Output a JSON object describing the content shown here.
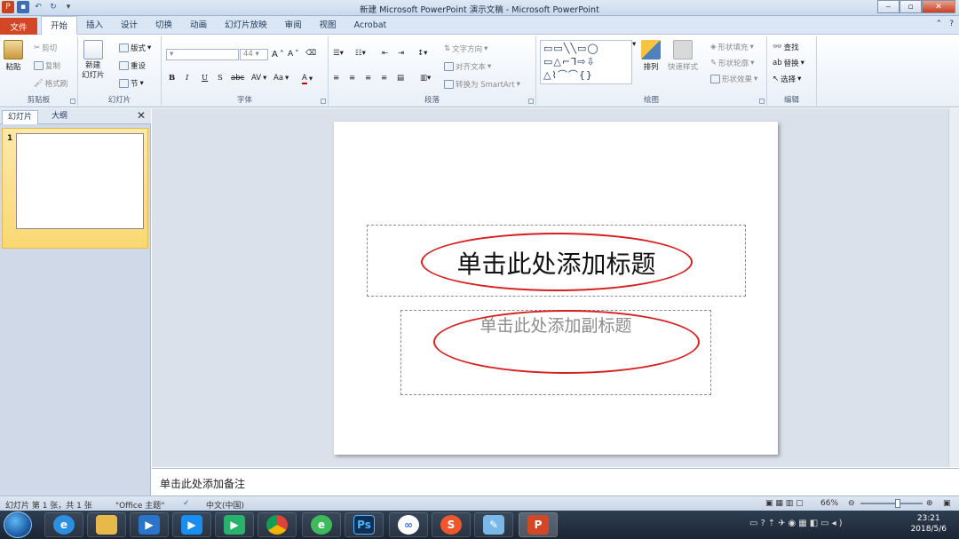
{
  "window": {
    "title": "新建 Microsoft PowerPoint 演示文稿 - Microsoft PowerPoint",
    "ppt_letter": "P",
    "min": "‒",
    "max": "▫",
    "close": "✕"
  },
  "tabs": {
    "file": "文件",
    "items": [
      "开始",
      "插入",
      "设计",
      "切换",
      "动画",
      "幻灯片放映",
      "审阅",
      "视图",
      "Acrobat"
    ],
    "active": "开始",
    "help": "?"
  },
  "ribbon": {
    "clipboard": {
      "paste": "粘贴",
      "cut": "剪切",
      "copy": "复制",
      "format_painter": "格式刷",
      "label": "剪贴板"
    },
    "slides": {
      "new_slide": "新建\n幻灯片",
      "layout": "版式",
      "reset": "重设",
      "section": "节",
      "label": "幻灯片"
    },
    "font": {
      "size": "44",
      "label": "字体",
      "grow": "A",
      "shrink": "A",
      "bold": "B",
      "italic": "I",
      "underline": "U",
      "strike": "S",
      "shadow": "abc",
      "spacing": "AV",
      "case": "Aa",
      "color": "A"
    },
    "paragraph": {
      "text_direction": "文字方向",
      "align_text": "对齐文本",
      "smartart": "转换为 SmartArt",
      "label": "段落"
    },
    "drawing": {
      "arrange": "排列",
      "quick_styles": "快速样式",
      "shape_fill": "形状填充",
      "shape_outline": "形状轮廓",
      "shape_effects": "形状效果",
      "label": "绘图"
    },
    "editing": {
      "find": "查找",
      "replace": "替换",
      "select": "选择",
      "label": "编辑"
    }
  },
  "panel": {
    "tab_slides": "幻灯片",
    "tab_outline": "大纲",
    "close": "✕",
    "slide_number": "1"
  },
  "slide": {
    "title_placeholder": "单击此处添加标题",
    "subtitle_placeholder": "单击此处添加副标题",
    "annotation_color": "#d42020"
  },
  "notes": {
    "placeholder": "单击此处添加备注"
  },
  "status": {
    "slide_info": "幻灯片 第 1 张，共 1 张",
    "theme": "\"Office 主题\"",
    "language": "中文(中国)",
    "zoom": "66%",
    "zoom_level": 0.6
  },
  "taskbar": {
    "ps": "Ps",
    "time": "23:21",
    "date": "2018/5/6"
  }
}
